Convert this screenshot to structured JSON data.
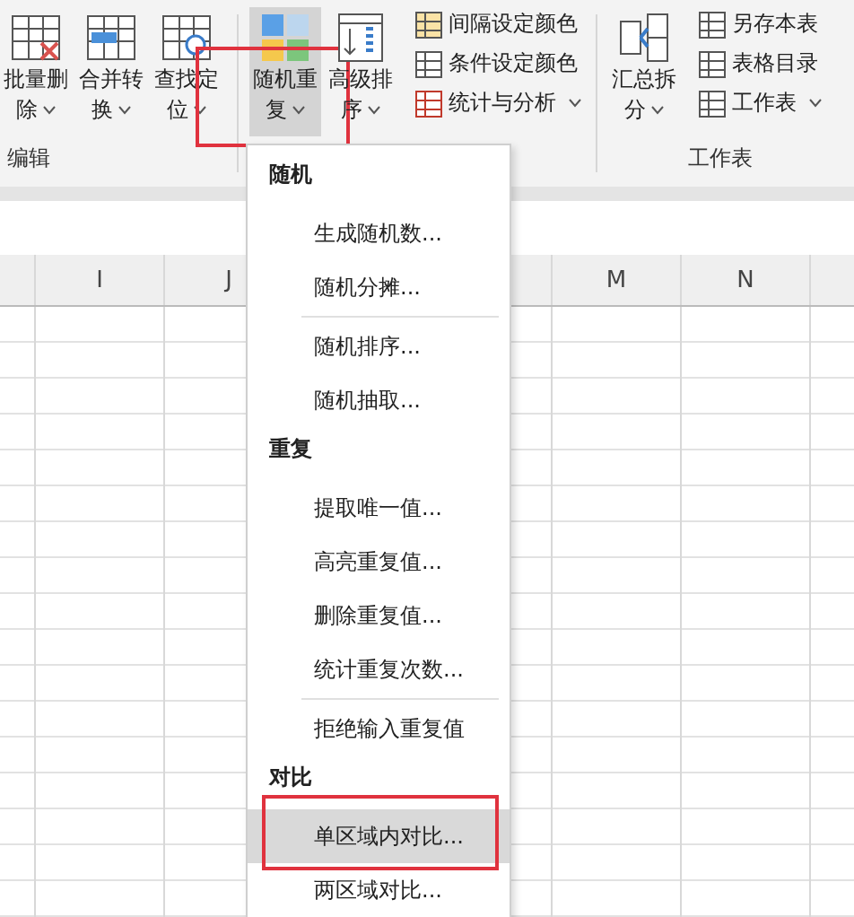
{
  "ribbon": {
    "groups": [
      {
        "label": "编辑",
        "items": [
          {
            "kind": "large",
            "lines": [
              "批量删",
              "除"
            ],
            "dropdown": true,
            "selected": false,
            "highlighted": false
          },
          {
            "kind": "large",
            "lines": [
              "合并转",
              "换"
            ],
            "dropdown": true,
            "selected": false,
            "highlighted": false
          },
          {
            "kind": "large",
            "lines": [
              "查找定",
              "位"
            ],
            "dropdown": true,
            "selected": false,
            "highlighted": false
          }
        ]
      },
      {
        "items": [
          {
            "kind": "large",
            "lines": [
              "随机重",
              "复"
            ],
            "dropdown": true,
            "selected": true,
            "highlighted": true
          },
          {
            "kind": "large",
            "lines": [
              "高级排",
              "序"
            ],
            "dropdown": true,
            "selected": false,
            "highlighted": false
          },
          {
            "kind": "small_column",
            "buttons": [
              {
                "label": "间隔设定颜色",
                "dropdown": false
              },
              {
                "label": "条件设定颜色",
                "dropdown": false
              },
              {
                "label": "统计与分析",
                "dropdown": true
              }
            ]
          }
        ]
      },
      {
        "label": "工作表",
        "items": [
          {
            "kind": "large",
            "lines": [
              "汇总拆",
              "分"
            ],
            "dropdown": true,
            "selected": false,
            "highlighted": false
          },
          {
            "kind": "small_column",
            "buttons": [
              {
                "label": "另存本表",
                "dropdown": false
              },
              {
                "label": "表格目录",
                "dropdown": false
              },
              {
                "label": "工作表",
                "dropdown": true
              }
            ]
          }
        ]
      }
    ]
  },
  "sheet": {
    "columns": [
      "I",
      "J",
      "M",
      "N"
    ]
  },
  "menu": {
    "items": [
      {
        "kind": "header",
        "label": "随机"
      },
      {
        "kind": "item",
        "label": "生成随机数...",
        "selected": false,
        "highlighted": false
      },
      {
        "kind": "item",
        "label": "随机分摊...",
        "selected": false,
        "highlighted": false
      },
      {
        "kind": "separator"
      },
      {
        "kind": "item",
        "label": "随机排序...",
        "selected": false,
        "highlighted": false
      },
      {
        "kind": "item",
        "label": "随机抽取...",
        "selected": false,
        "highlighted": false
      },
      {
        "kind": "header",
        "label": "重复"
      },
      {
        "kind": "item",
        "label": "提取唯一值...",
        "selected": false,
        "highlighted": false
      },
      {
        "kind": "item",
        "label": "高亮重复值...",
        "selected": false,
        "highlighted": false
      },
      {
        "kind": "item",
        "label": "删除重复值...",
        "selected": false,
        "highlighted": false
      },
      {
        "kind": "item",
        "label": "统计重复次数...",
        "selected": false,
        "highlighted": false
      },
      {
        "kind": "separator"
      },
      {
        "kind": "item",
        "label": "拒绝输入重复值",
        "selected": false,
        "highlighted": false
      },
      {
        "kind": "header",
        "label": "对比"
      },
      {
        "kind": "item",
        "label": "单区域内对比...",
        "selected": true,
        "highlighted": true
      },
      {
        "kind": "item",
        "label": "两区域对比...",
        "selected": false,
        "highlighted": false
      }
    ]
  }
}
